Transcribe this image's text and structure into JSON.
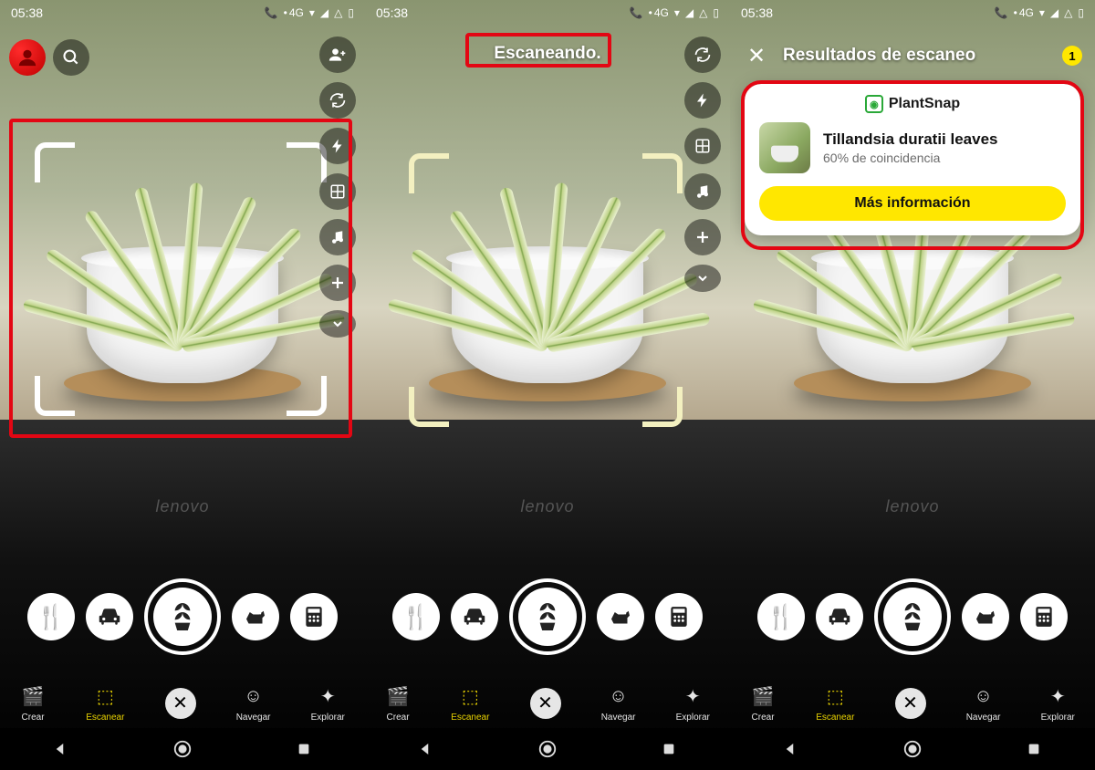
{
  "status": {
    "time": "05:38",
    "net_label": "4G"
  },
  "screen1": {
    "side_icons": [
      "add-friend-icon",
      "rotate-icon",
      "flash-icon",
      "grid-icon",
      "music-icon",
      "plus-icon",
      "chevron-down-icon"
    ]
  },
  "screen2": {
    "scanning_label": "Escaneando.",
    "side_icons": [
      "rotate-icon",
      "flash-icon",
      "grid-icon",
      "music-icon",
      "plus-icon",
      "chevron-down-icon"
    ]
  },
  "screen3": {
    "results_label": "Resultados de escaneo",
    "results_count": "1",
    "card": {
      "brand": "PlantSnap",
      "title": "Tillandsia duratii leaves",
      "match": "60% de coincidencia",
      "more": "Más información"
    }
  },
  "chips": [
    "food-icon",
    "car-icon",
    "plant-icon",
    "dog-icon",
    "calculator-icon"
  ],
  "toolbar": {
    "crear": "Crear",
    "escanear": "Escanear",
    "navegar": "Navegar",
    "explorar": "Explorar"
  },
  "decor": {
    "laptop_brand": "lenovo"
  }
}
